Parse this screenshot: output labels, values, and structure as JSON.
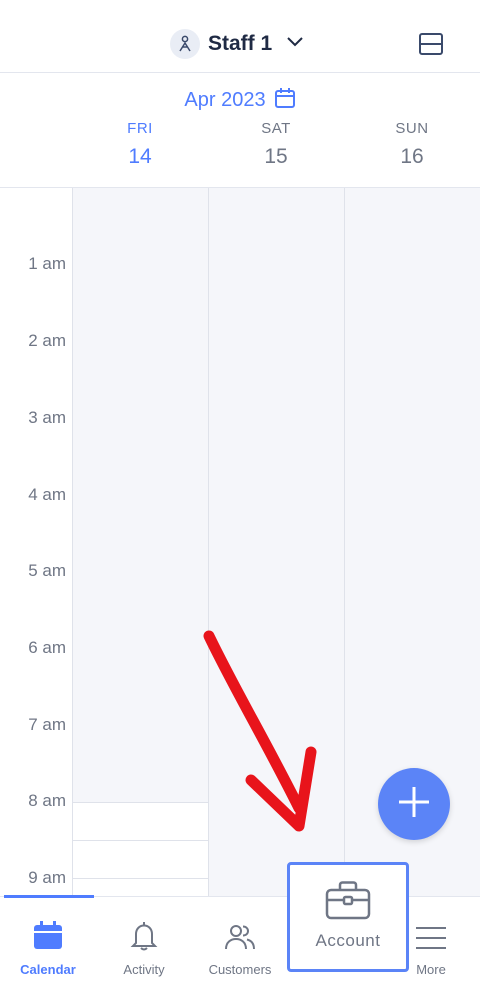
{
  "header": {
    "staff_name": "Staff 1",
    "icons": {
      "avatar": "person-icon",
      "dropdown": "chevron-down-icon",
      "layout": "layout-rows-icon"
    }
  },
  "calendar": {
    "month_label": "Apr 2023",
    "days": [
      {
        "name": "FRI",
        "num": "14",
        "active": true
      },
      {
        "name": "SAT",
        "num": "15",
        "active": false
      },
      {
        "name": "SUN",
        "num": "16",
        "active": false
      }
    ],
    "time_labels": [
      "1 am",
      "2 am",
      "3 am",
      "4 am",
      "5 am",
      "6 am",
      "7 am",
      "8 am",
      "9 am"
    ]
  },
  "fab": {
    "icon": "plus-icon"
  },
  "tabbar": {
    "tabs": [
      {
        "label": "Calendar",
        "icon": "calendar-icon",
        "active": true
      },
      {
        "label": "Activity",
        "icon": "bell-icon",
        "active": false
      },
      {
        "label": "Customers",
        "icon": "users-icon",
        "active": false
      },
      {
        "label": "Account",
        "icon": "briefcase-icon",
        "active": false,
        "highlighted": true
      },
      {
        "label": "More",
        "icon": "menu-icon",
        "active": false
      }
    ]
  },
  "colors": {
    "accent": "#4f7cff",
    "fab": "#5b84f7",
    "annotation_arrow": "#e8141b",
    "grid_bg": "#f5f6fa",
    "text_muted": "#6f7685"
  }
}
